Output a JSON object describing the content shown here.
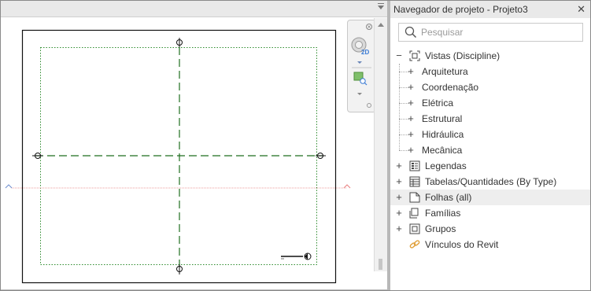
{
  "panel": {
    "title": "Navegador de projeto - Projeto3",
    "close_glyph": "✕"
  },
  "search": {
    "placeholder": "Pesquisar",
    "value": ""
  },
  "navbar": {
    "badge_2d": "2D"
  },
  "tree": {
    "root": {
      "label": "Vistas (Discipline)",
      "icon": "view-group-icon",
      "expander": "−"
    },
    "children": [
      {
        "label": "Arquitetura",
        "expander": "+"
      },
      {
        "label": "Coordenação",
        "expander": "+"
      },
      {
        "label": "Elétrica",
        "expander": "+"
      },
      {
        "label": "Estrutural",
        "expander": "+"
      },
      {
        "label": "Hidráulica",
        "expander": "+"
      },
      {
        "label": "Mecânica",
        "expander": "+"
      }
    ],
    "items": [
      {
        "label": "Legendas",
        "icon": "legend-icon",
        "expander": "+"
      },
      {
        "label": "Tabelas/Quantidades (By Type)",
        "icon": "schedule-icon",
        "expander": "+"
      },
      {
        "label": "Folhas (all)",
        "icon": "sheet-icon",
        "expander": "+",
        "selected": true
      },
      {
        "label": "Famílias",
        "icon": "families-icon",
        "expander": "+"
      },
      {
        "label": "Grupos",
        "icon": "groups-icon",
        "expander": "+"
      },
      {
        "label": "Vínculos do Revit",
        "icon": "link-icon",
        "expander": ""
      }
    ]
  },
  "colors": {
    "grid_line": "#1e6e1e",
    "level_line": "#e87f7f",
    "level_marker": "#6f8ecf",
    "link_icon": "#e0a03a",
    "selected_row": "#eeeeee"
  }
}
